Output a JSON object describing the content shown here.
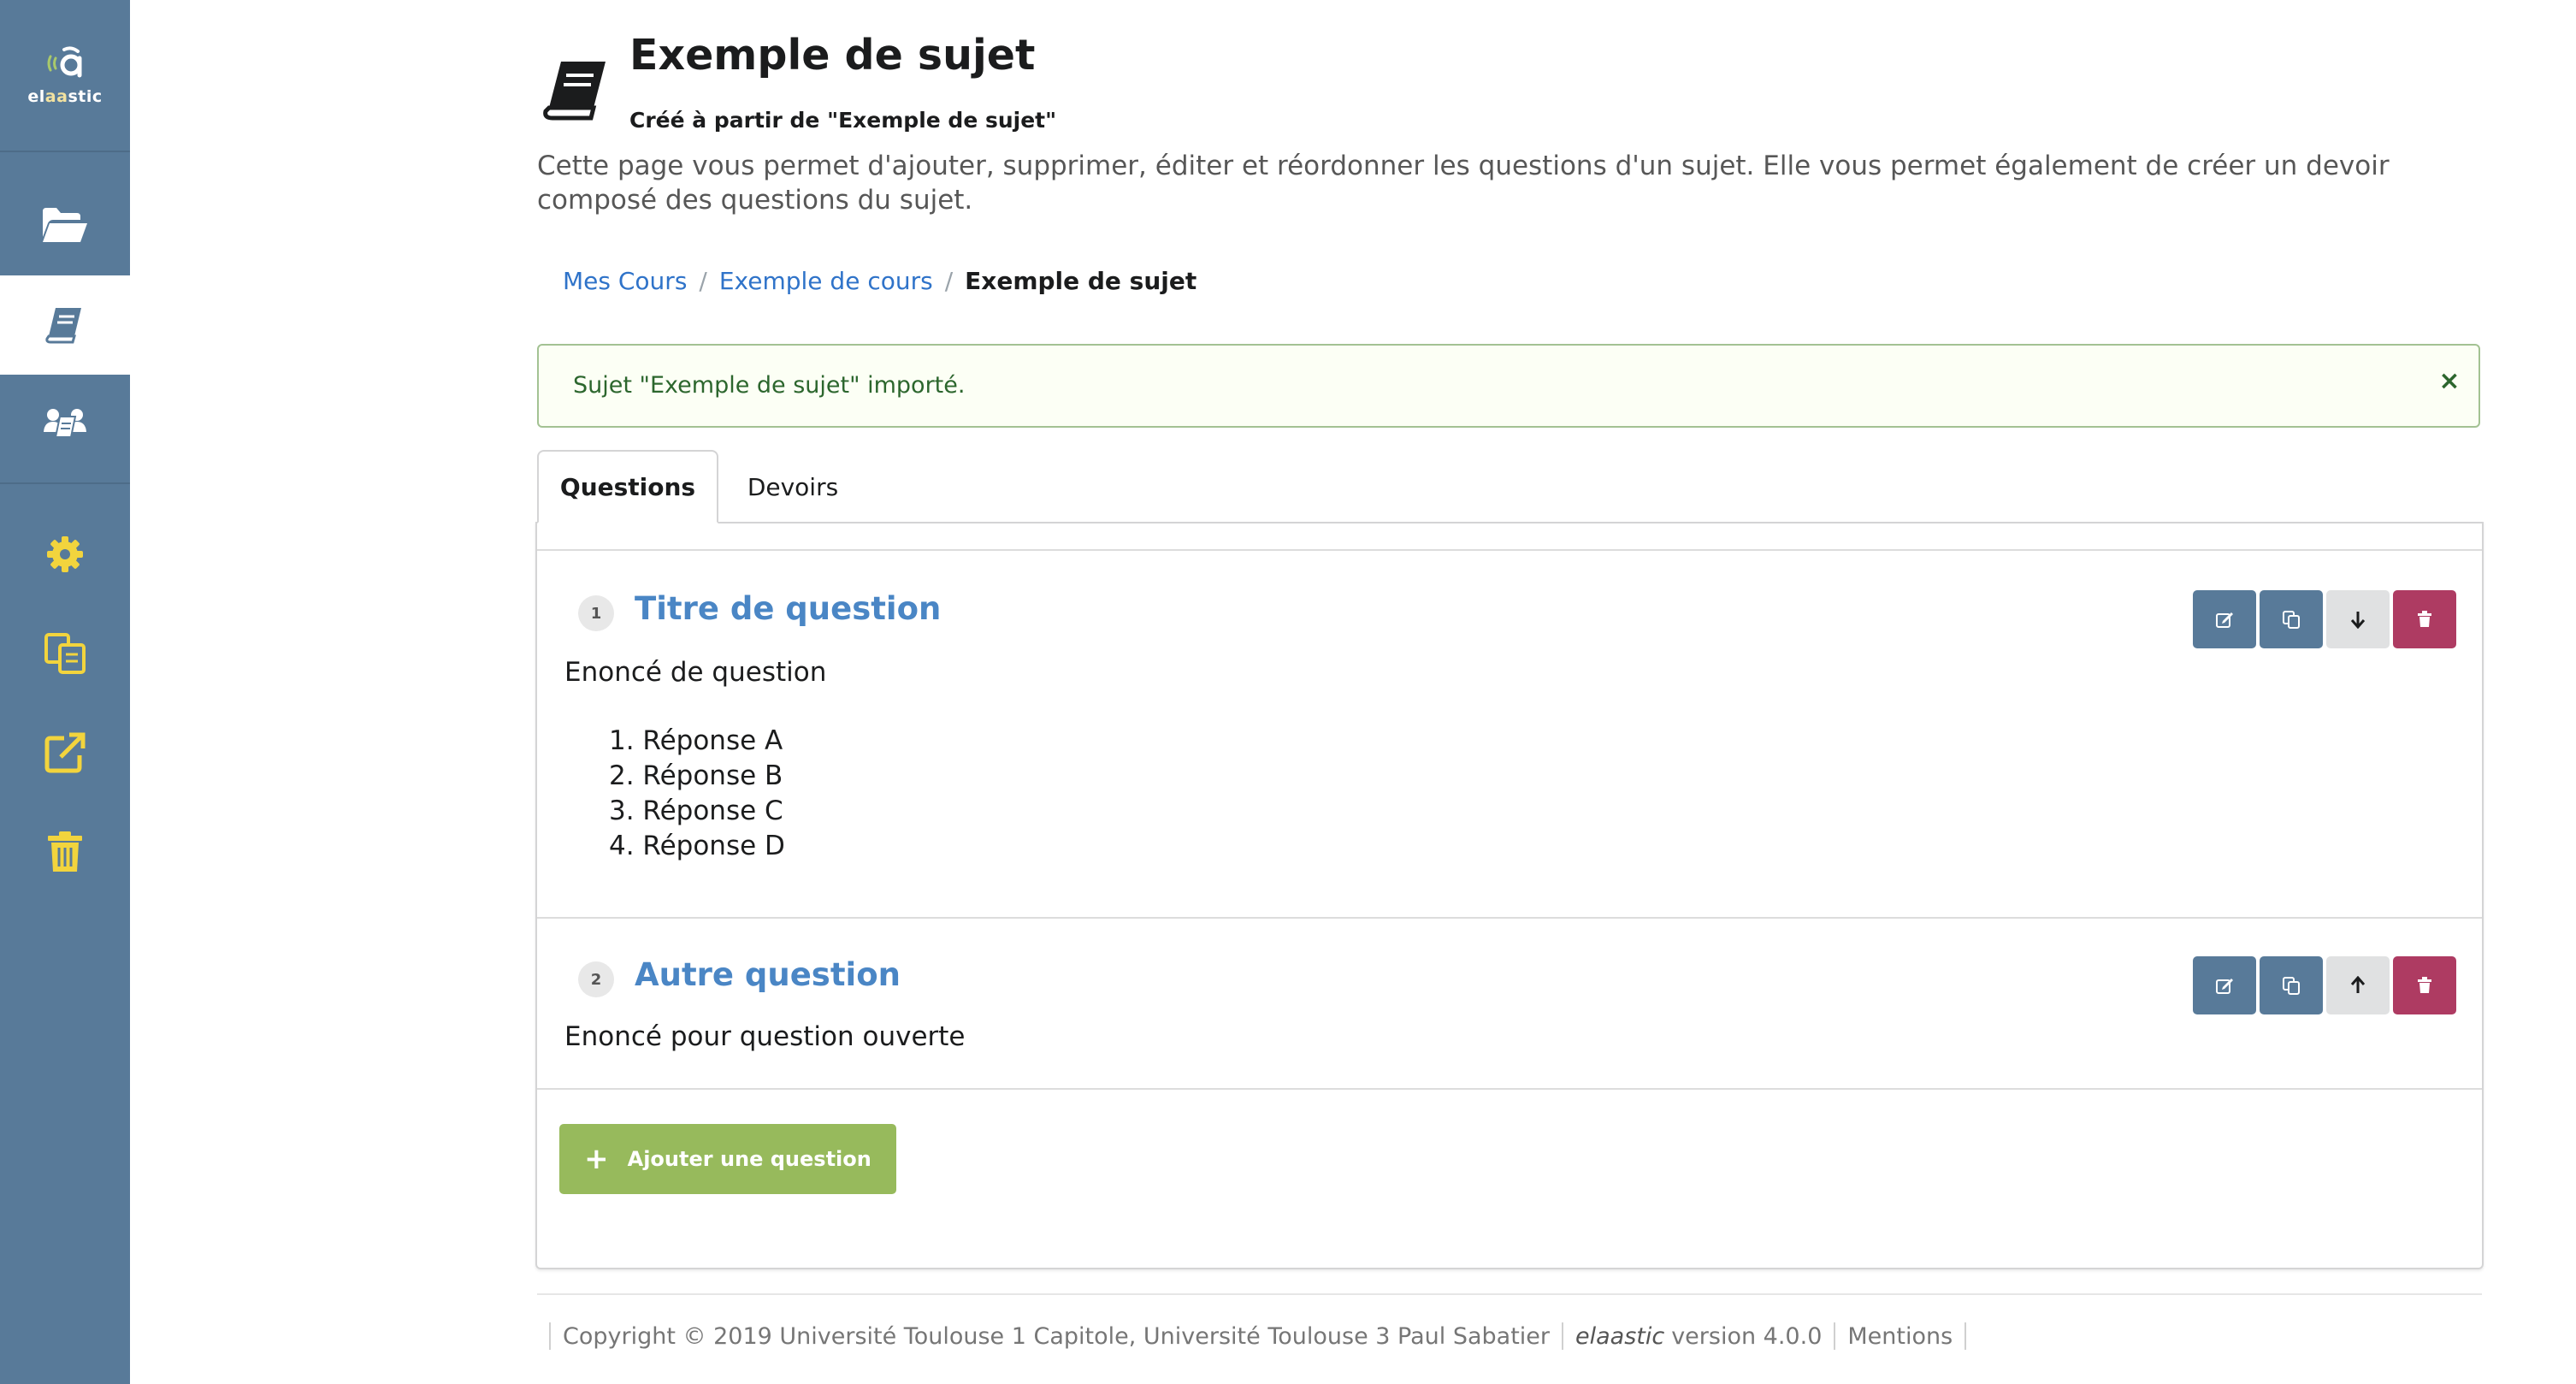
{
  "app": {
    "logo_text_prefix": "el",
    "logo_text_accent": "aa",
    "logo_text_suffix": "stic"
  },
  "sidebar": {
    "items": [
      {
        "icon": "folder-open-icon",
        "active": false
      },
      {
        "icon": "book-icon",
        "active": true
      },
      {
        "icon": "users-icon",
        "active": false
      },
      {
        "icon": "gear-icon",
        "active": false
      },
      {
        "icon": "copy-icon",
        "active": false
      },
      {
        "icon": "external-link-icon",
        "active": false
      },
      {
        "icon": "trash-icon",
        "active": false
      }
    ],
    "icon_color": "#f2d43d",
    "background": "#587a99"
  },
  "header": {
    "title": "Exemple de sujet",
    "subtitle": "Créé à partir de \"Exemple de sujet\"",
    "description": "Cette page vous permet d'ajouter, supprimer, éditer et réordonner les questions d'un sujet. Elle vous permet également de créer un devoir composé des questions du sujet."
  },
  "breadcrumb": {
    "items": [
      "Mes Cours",
      "Exemple de cours"
    ],
    "current": "Exemple de sujet",
    "divider": "/"
  },
  "alert": {
    "message": "Sujet \"Exemple de sujet\" importé.",
    "close": "×"
  },
  "tabs": [
    {
      "label": "Questions",
      "active": true
    },
    {
      "label": "Devoirs",
      "active": false
    }
  ],
  "questions": [
    {
      "number": "1",
      "title": "Titre de question",
      "statement": "Enoncé de question",
      "choices": [
        "1. Réponse A",
        "2. Réponse B",
        "3. Réponse C",
        "4. Réponse D"
      ],
      "actions": [
        "edit-icon",
        "duplicate-icon",
        "arrow-down-icon",
        "delete-icon"
      ]
    },
    {
      "number": "2",
      "title": "Autre question",
      "statement": "Enoncé pour question ouverte",
      "choices": [],
      "actions": [
        "edit-icon",
        "duplicate-icon",
        "arrow-up-icon",
        "delete-icon"
      ]
    }
  ],
  "add_question": {
    "plus": "+",
    "label": "Ajouter une question"
  },
  "footer": {
    "copyright": "Copyright © 2019 Université Toulouse 1 Capitole, Université Toulouse 3 Paul Sabatier",
    "app_name": "elaastic",
    "version": "version 4.0.0",
    "mentions": "Mentions"
  },
  "colors": {
    "primary_blue": "#587a99",
    "link_blue": "#2f73c9",
    "question_title": "#4a86c5",
    "delete_red": "#ae3b62",
    "add_green": "#97ba5c",
    "alert_green": "#2c662d"
  }
}
